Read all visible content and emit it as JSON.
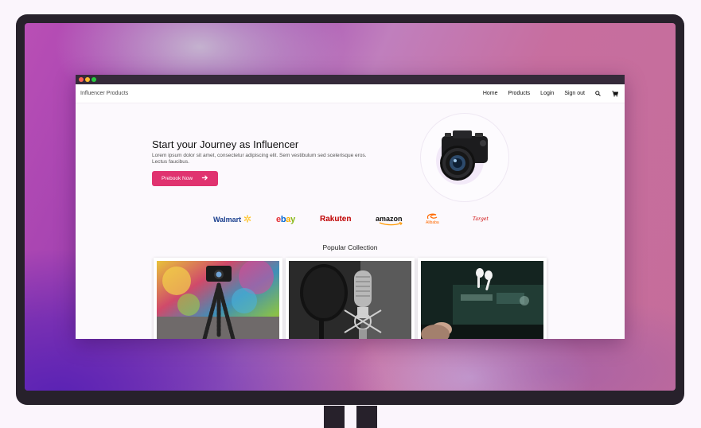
{
  "window": {
    "brand": "Influencer Products"
  },
  "nav": {
    "links": [
      "Home",
      "Products",
      "Login",
      "Sign out"
    ],
    "icons": [
      "search-icon",
      "cart-icon"
    ]
  },
  "hero": {
    "title": "Start your Journey as Influencer",
    "text": "Lorem ipsum dolor sit amet, consectetur adipiscing elit. Sem vestibulum sed scelerisque eros. Lectus faucibus.",
    "cta_label": "Prebook Now",
    "image": "camera"
  },
  "brands": [
    "Walmart",
    "ebay",
    "Rakuten",
    "amazon",
    "Alibaba",
    "Target"
  ],
  "collection": {
    "title": "Popular Collection",
    "items": [
      "tripod-camera",
      "studio-microphone",
      "wireless-earbuds"
    ]
  },
  "colors": {
    "accent": "#e0336f",
    "titlebar": "#352a3a",
    "monitor": "#27212b"
  }
}
